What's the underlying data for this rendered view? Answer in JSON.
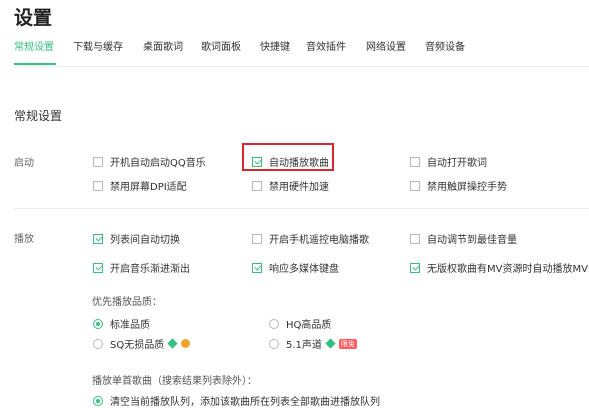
{
  "title": "设置",
  "tabs": [
    "常规设置",
    "下载与缓存",
    "桌面歌词",
    "歌词面板",
    "快捷键",
    "音效插件",
    "网络设置",
    "音频设备"
  ],
  "section_title": "常规设置",
  "startup": {
    "label": "启动",
    "options": [
      {
        "label": "开机自动启动QQ音乐",
        "checked": false
      },
      {
        "label": "自动播放歌曲",
        "checked": true
      },
      {
        "label": "自动打开歌词",
        "checked": false
      },
      {
        "label": "禁用屏幕DPI适配",
        "checked": false
      },
      {
        "label": "禁用硬件加速",
        "checked": false
      },
      {
        "label": "禁用触屏操控手势",
        "checked": false
      }
    ]
  },
  "playback": {
    "label": "播放",
    "options": [
      {
        "label": "列表间自动切换",
        "checked": true
      },
      {
        "label": "开启手机遥控电脑播歌",
        "checked": false
      },
      {
        "label": "自动调节到最佳音量",
        "checked": false
      },
      {
        "label": "开启音乐渐进渐出",
        "checked": true
      },
      {
        "label": "响应多媒体键盘",
        "checked": true
      },
      {
        "label": "无版权歌曲有MV资源时自动播放MV",
        "checked": true
      }
    ],
    "quality_title": "优先播放品质：",
    "quality_options": [
      {
        "label": "标准品质",
        "checked": true
      },
      {
        "label": "HQ高品质",
        "checked": false
      },
      {
        "label": "SQ无损品质",
        "checked": false
      },
      {
        "label": "5.1声道",
        "checked": false
      }
    ],
    "limit_badge": "限免",
    "single_title": "播放单首歌曲（搜索结果列表除外）：",
    "single_options": [
      {
        "label": "清空当前播放队列，添加该歌曲所在列表全部歌曲进播放队列",
        "checked": true
      }
    ]
  },
  "colors": {
    "accent": "#31c27c",
    "highlight": "#d9262d"
  }
}
